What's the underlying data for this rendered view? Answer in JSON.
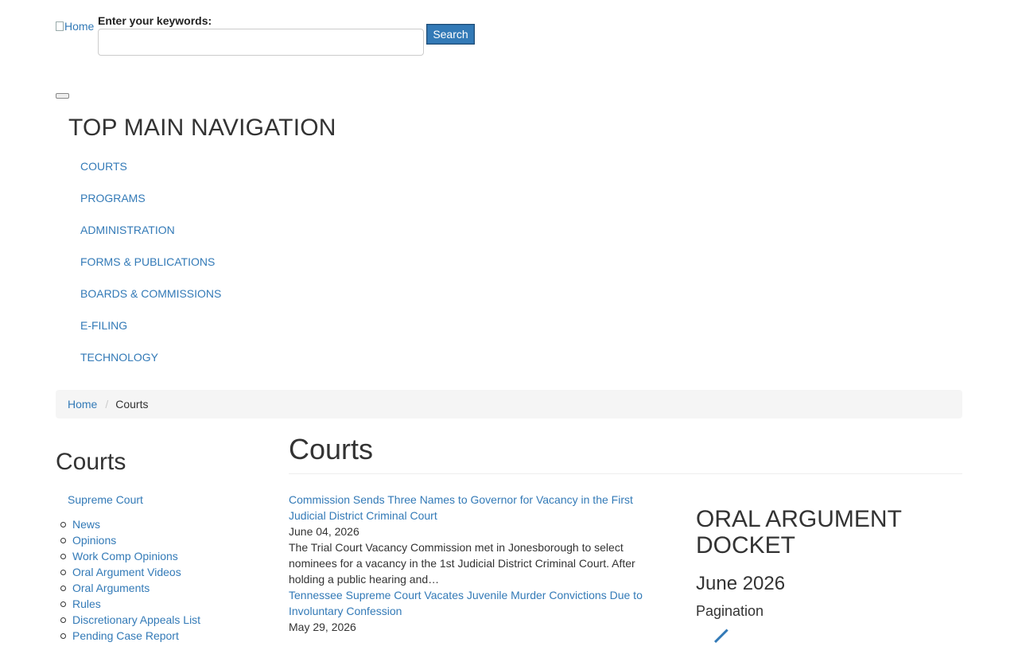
{
  "header": {
    "logo_alt": "Home",
    "search_label": "Enter your keywords:",
    "search_value": "",
    "search_button": "Search"
  },
  "nav": {
    "heading": "TOP MAIN NAVIGATION",
    "items": [
      "COURTS",
      "PROGRAMS",
      "ADMINISTRATION",
      "FORMS & PUBLICATIONS",
      "BOARDS & COMMISSIONS",
      "E-FILING",
      "TECHNOLOGY"
    ]
  },
  "breadcrumb": {
    "home": "Home",
    "separator": "/",
    "current": "Courts"
  },
  "sidebar": {
    "title": "Courts",
    "parent": "Supreme Court",
    "items": [
      "News",
      "Opinions",
      "Work Comp Opinions",
      "Oral Argument Videos",
      "Oral Arguments",
      "Rules",
      "Discretionary Appeals List",
      "Pending Case Report"
    ]
  },
  "main": {
    "title": "Courts",
    "news": [
      {
        "title": "Commission Sends Three Names to Governor for Vacancy in the First Judicial District Criminal Court",
        "date": "June 04, 2026",
        "summary": "The Trial Court Vacancy Commission met in Jonesborough to select nominees for a vacancy in the 1st Judicial District Criminal Court. After holding a public hearing and…"
      },
      {
        "title": "Tennessee Supreme Court Vacates Juvenile Murder Convictions Due to Involuntary Confession",
        "date": "May 29, 2026",
        "summary": ""
      }
    ]
  },
  "docket": {
    "title": "ORAL ARGUMENT DOCKET",
    "month": "June 2026",
    "pagination": "Pagination"
  },
  "colors": {
    "link": "#337ab7",
    "button": "#337ab7",
    "breadcrumb_bg": "#f5f5f5"
  }
}
